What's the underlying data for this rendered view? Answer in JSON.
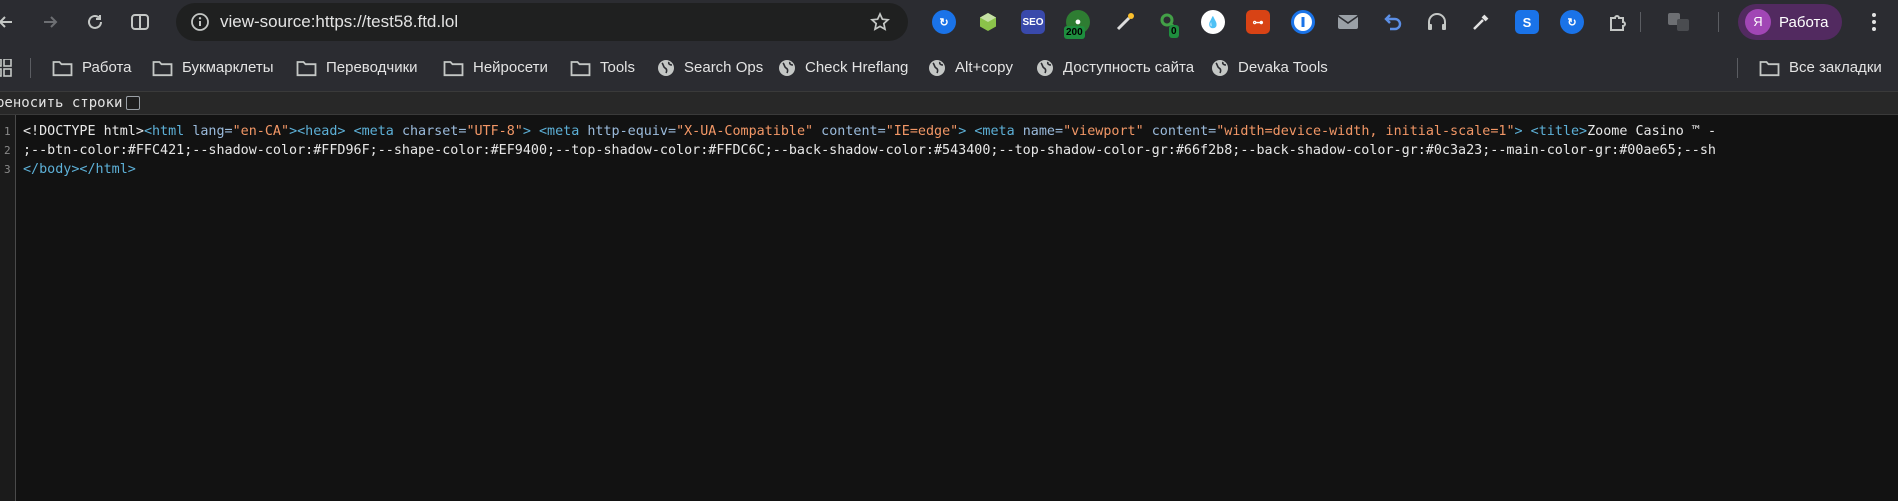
{
  "toolbar": {
    "url": "view-source:https://test58.ftd.lol",
    "badges": {
      "ext_green_count": "200",
      "ext_key_count": "0"
    },
    "ext_seo_label": "SEO",
    "ext_s_label": "S",
    "profile": {
      "initial": "Я",
      "name": "Работа"
    },
    "colors": {
      "profile_bg": "#522a60",
      "avatar_bg": "#a146b5"
    }
  },
  "bookmarks": {
    "items": [
      {
        "label": "Работа",
        "icon": "folder-icon"
      },
      {
        "label": "Букмарклеты",
        "icon": "folder-icon"
      },
      {
        "label": "Переводчики",
        "icon": "folder-icon"
      },
      {
        "label": "Нейросети",
        "icon": "folder-icon"
      },
      {
        "label": "Tools",
        "icon": "folder-icon"
      },
      {
        "label": "Search Ops",
        "icon": "globe-icon"
      },
      {
        "label": "Check Hreflang",
        "icon": "globe-icon"
      },
      {
        "label": "Alt+copy",
        "icon": "globe-icon"
      },
      {
        "label": "Доступность сайта",
        "icon": "globe-icon"
      },
      {
        "label": "Devaka Tools",
        "icon": "globe-icon"
      }
    ],
    "all_bookmarks": "Все закладки"
  },
  "source": {
    "wrap_label": "реносить строки",
    "line_numbers": [
      "1",
      "2",
      "3"
    ],
    "line1": {
      "p1": "<!DOCTYPE html>",
      "p2": "<html ",
      "p3": "lang=",
      "p4": "\"en-CA\"",
      "p5": "><head>",
      "p6": " ",
      "p7": "<meta ",
      "p8": "charset=",
      "p9": "\"UTF-8\"",
      "p10": ">",
      "p11": " ",
      "p12": "<meta ",
      "p13": "http-equiv=",
      "p14": "\"X-UA-Compatible\"",
      "p15": " content=",
      "p16": "\"IE=edge\"",
      "p17": ">",
      "p18": " ",
      "p19": "<meta ",
      "p20": "name=",
      "p21": "\"viewport\"",
      "p22": " content=",
      "p23": "\"width=device-width, initial-scale=1\"",
      "p24": ">",
      "p25": " ",
      "p26": "<title>",
      "p27": "Zoome Casino ™ -"
    },
    "line2": ";--btn-color:#FFC421;--shadow-color:#FFD96F;--shape-color:#EF9400;--top-shadow-color:#FFDC6C;--back-shadow-color:#543400;--top-shadow-color-gr:#66f2b8;--back-shadow-color-gr:#0c3a23;--main-color-gr:#00ae65;--sh",
    "line3": "</body></html>"
  }
}
